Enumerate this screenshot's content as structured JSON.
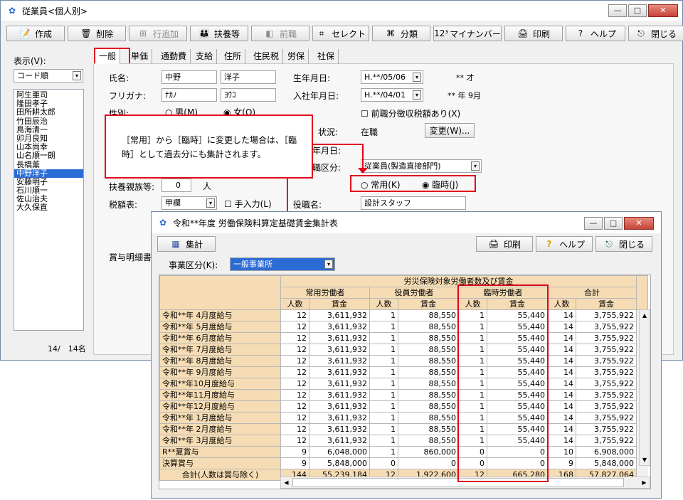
{
  "main": {
    "title": "従業員<個人別>",
    "toolbar": [
      {
        "label": "作成",
        "icon": "📝",
        "enabled": true
      },
      {
        "label": "削除",
        "icon": "🗑",
        "enabled": true
      },
      {
        "label": "行追加",
        "icon": "⊞",
        "enabled": false
      },
      {
        "label": "扶養等",
        "icon": "👪",
        "enabled": true
      },
      {
        "label": "前職",
        "icon": "◧",
        "enabled": false
      },
      {
        "label": "セレクト",
        "icon": "⌗",
        "enabled": true
      },
      {
        "label": "分類",
        "icon": "⌘",
        "enabled": true
      },
      {
        "label": "マイナンバー",
        "icon": "12³",
        "enabled": true
      },
      {
        "label": "印刷",
        "icon": "🖨",
        "enabled": true
      },
      {
        "label": "ヘルプ",
        "icon": "?",
        "enabled": true
      },
      {
        "label": "閉じる",
        "icon": "⎋",
        "enabled": true
      }
    ],
    "sidebar": {
      "display_label": "表示(V):",
      "sort_value": "コード順",
      "employees": [
        "阿生亜司",
        "隆田孝子",
        "田所耕太郎",
        "竹田辰治",
        "鳥海清一",
        "卯月良知",
        "山本尚幸",
        "山名順一朗",
        "長橋薫",
        "中野洋子",
        "安藤明子",
        "石川順一",
        "佐山治夫",
        "大久保直"
      ],
      "selected_index": 9,
      "count": "14/　14名"
    },
    "tabs": [
      "一般",
      "単価",
      "通勤費",
      "支給",
      "住所",
      "住民税",
      "労保",
      "社保"
    ],
    "form": {
      "name_label": "氏名:",
      "last_name": "中野",
      "first_name": "洋子",
      "kana_label": "フリガナ:",
      "last_kana": "ﾅｶﾉ",
      "first_kana": "ﾖｳｺ",
      "gender_label": "性別:",
      "male": "男(M)",
      "female": "女(O)",
      "birth_label": "生年月日:",
      "birth_value": "H.**/05/06",
      "age": "** 才",
      "hire_label": "入社年月日:",
      "hire_value": "H.**/04/01",
      "tenure": "** 年 9月",
      "prev_job": "前職分徴収税額あり(X)",
      "status_label": "状況:",
      "status_value": "在職",
      "change_button": "変更(W)...",
      "retire_label": "年月日:",
      "category_label": "職区分:",
      "category_value": "従業員(製造直接部門)",
      "regular": "常用(K)",
      "temporary": "臨時(J)",
      "dependents_label": "扶養親族等:",
      "dependents_value": "0",
      "dependents_unit": "人",
      "tax_table_label": "税額表:",
      "tax_table_value": "甲欄",
      "manual_input": "手入力(L)",
      "position_label": "役職名:",
      "position_value": "設計スタッフ",
      "bonus_label": "賞与明細書"
    },
    "callout": "［常用］から［臨時］に変更した場合は、［臨時］として過去分にも集計されます。"
  },
  "sub": {
    "title": "令和**年度 労働保険料算定基礎賃金集計表",
    "calc_button": "集計",
    "print_button": "印刷",
    "help_button": "ヘルプ",
    "close_button": "閉じる",
    "division_label": "事業区分(K):",
    "division_value": "一般事業所",
    "table": {
      "group_header": "労災保険対象労働者数及び賃金",
      "groups": [
        "常用労働者",
        "役員労働者",
        "臨時労働者",
        "合計"
      ],
      "sub_headers": [
        "人数",
        "賃金"
      ],
      "rows": [
        [
          "令和**年 4月度給与",
          "12",
          "3,611,932",
          "1",
          "88,550",
          "1",
          "55,440",
          "14",
          "3,755,922"
        ],
        [
          "令和**年 5月度給与",
          "12",
          "3,611,932",
          "1",
          "88,550",
          "1",
          "55,440",
          "14",
          "3,755,922"
        ],
        [
          "令和**年 6月度給与",
          "12",
          "3,611,932",
          "1",
          "88,550",
          "1",
          "55,440",
          "14",
          "3,755,922"
        ],
        [
          "令和**年 7月度給与",
          "12",
          "3,611,932",
          "1",
          "88,550",
          "1",
          "55,440",
          "14",
          "3,755,922"
        ],
        [
          "令和**年 8月度給与",
          "12",
          "3,611,932",
          "1",
          "88,550",
          "1",
          "55,440",
          "14",
          "3,755,922"
        ],
        [
          "令和**年 9月度給与",
          "12",
          "3,611,932",
          "1",
          "88,550",
          "1",
          "55,440",
          "14",
          "3,755,922"
        ],
        [
          "令和**年10月度給与",
          "12",
          "3,611,932",
          "1",
          "88,550",
          "1",
          "55,440",
          "14",
          "3,755,922"
        ],
        [
          "令和**年11月度給与",
          "12",
          "3,611,932",
          "1",
          "88,550",
          "1",
          "55,440",
          "14",
          "3,755,922"
        ],
        [
          "令和**年12月度給与",
          "12",
          "3,611,932",
          "1",
          "88,550",
          "1",
          "55,440",
          "14",
          "3,755,922"
        ],
        [
          "令和**年 1月度給与",
          "12",
          "3,611,932",
          "1",
          "88,550",
          "1",
          "55,440",
          "14",
          "3,755,922"
        ],
        [
          "令和**年 2月度給与",
          "12",
          "3,611,932",
          "1",
          "88,550",
          "1",
          "55,440",
          "14",
          "3,755,922"
        ],
        [
          "令和**年 3月度給与",
          "12",
          "3,611,932",
          "1",
          "88,550",
          "1",
          "55,440",
          "14",
          "3,755,922"
        ],
        [
          "R**夏賞与",
          "9",
          "6,048,000",
          "1",
          "860,000",
          "0",
          "0",
          "10",
          "6,908,000"
        ],
        [
          "決算賞与",
          "9",
          "5,848,000",
          "0",
          "0",
          "0",
          "0",
          "9",
          "5,848,000"
        ]
      ],
      "total": [
        "合計(人数は賞与除く)",
        "144",
        "55,239,184",
        "12",
        "1,922,600",
        "12",
        "665,280",
        "168",
        "57,827,064"
      ]
    }
  }
}
